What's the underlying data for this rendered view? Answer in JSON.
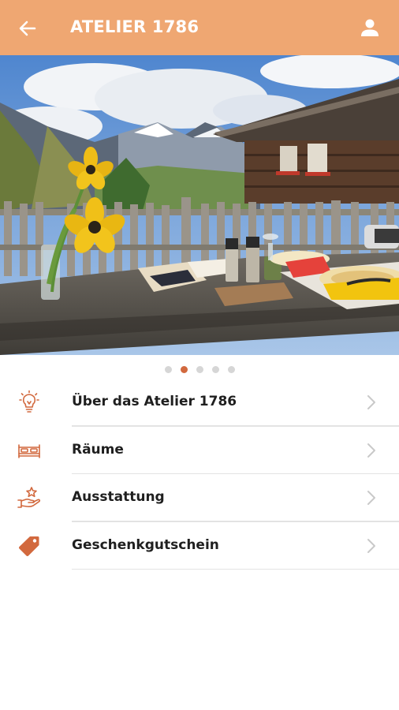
{
  "app_bar": {
    "title": "ATELIER 1786",
    "back_icon": "arrow-left-icon",
    "profile_icon": "person-icon",
    "background": "#efa772"
  },
  "carousel": {
    "image_subject": "Outdoor wooden table with yellow tulip, mountains and wooden chalet",
    "page_count": 5,
    "active_index": 1
  },
  "menu": {
    "accent_color": "#d2693e",
    "items": [
      {
        "label": "Über das Atelier 1786",
        "icon": "lightbulb-icon"
      },
      {
        "label": "Räume",
        "icon": "bed-icon"
      },
      {
        "label": "Ausstattung",
        "icon": "hand-star-icon"
      },
      {
        "label": "Geschenkgutschein",
        "icon": "tag-icon"
      }
    ]
  }
}
